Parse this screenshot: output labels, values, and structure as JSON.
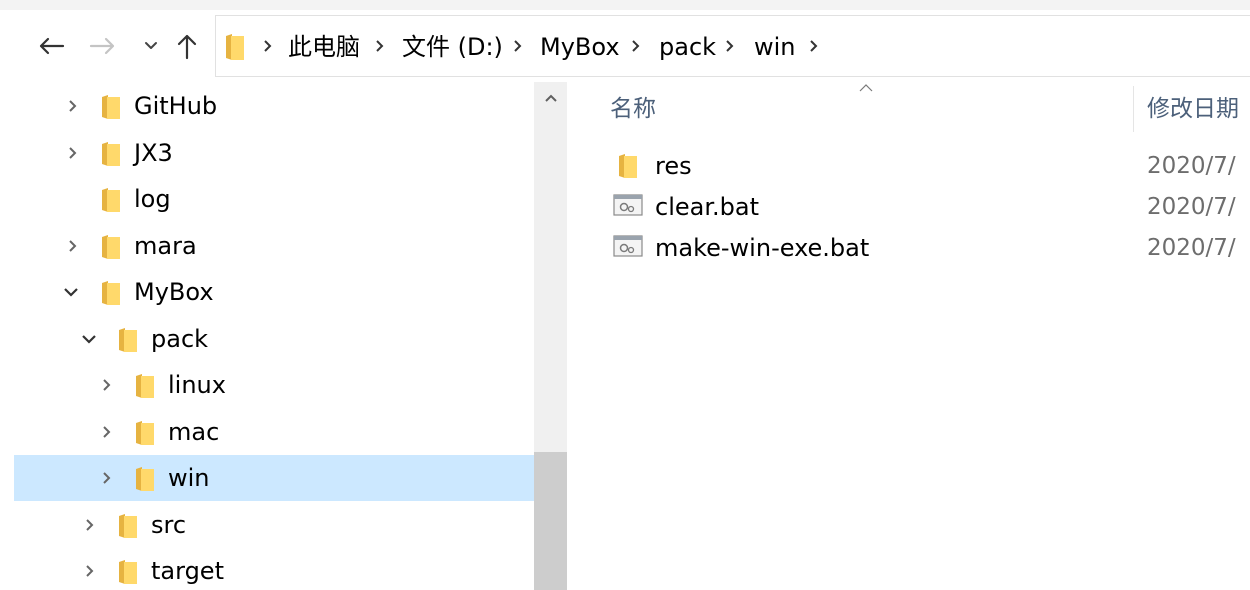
{
  "breadcrumb": {
    "items": [
      "此电脑",
      "文件 (D:)",
      "MyBox",
      "pack",
      "win"
    ]
  },
  "tree": {
    "items": [
      {
        "label": "GitHub",
        "expanded": false,
        "selected": false
      },
      {
        "label": "JX3",
        "expanded": false,
        "selected": false
      },
      {
        "label": "log",
        "expanded": null,
        "selected": false
      },
      {
        "label": "mara",
        "expanded": false,
        "selected": false
      },
      {
        "label": "MyBox",
        "expanded": true,
        "selected": false
      },
      {
        "label": "pack",
        "expanded": true,
        "selected": false
      },
      {
        "label": "linux",
        "expanded": false,
        "selected": false
      },
      {
        "label": "mac",
        "expanded": false,
        "selected": false
      },
      {
        "label": "win",
        "expanded": false,
        "selected": true
      },
      {
        "label": "src",
        "expanded": false,
        "selected": false
      },
      {
        "label": "target",
        "expanded": false,
        "selected": false
      }
    ]
  },
  "file_list": {
    "columns": {
      "name": "名称",
      "modified": "修改日期"
    },
    "rows": [
      {
        "name": "res",
        "type": "folder",
        "date": "2020/7/"
      },
      {
        "name": "clear.bat",
        "type": "batch-file",
        "date": "2020/7/"
      },
      {
        "name": "make-win-exe.bat",
        "type": "batch-file",
        "date": "2020/7/"
      }
    ]
  },
  "icons": {
    "back": "back-arrow-icon",
    "forward": "forward-arrow-icon",
    "recent": "chevron-down-icon",
    "up": "up-arrow-icon",
    "folder": "folder-icon",
    "batch": "batch-file-icon"
  },
  "colors": {
    "selection": "#cce8ff",
    "folder": "#ffd96b",
    "header_text": "#4c607a",
    "date_text": "#6d6d6d"
  }
}
